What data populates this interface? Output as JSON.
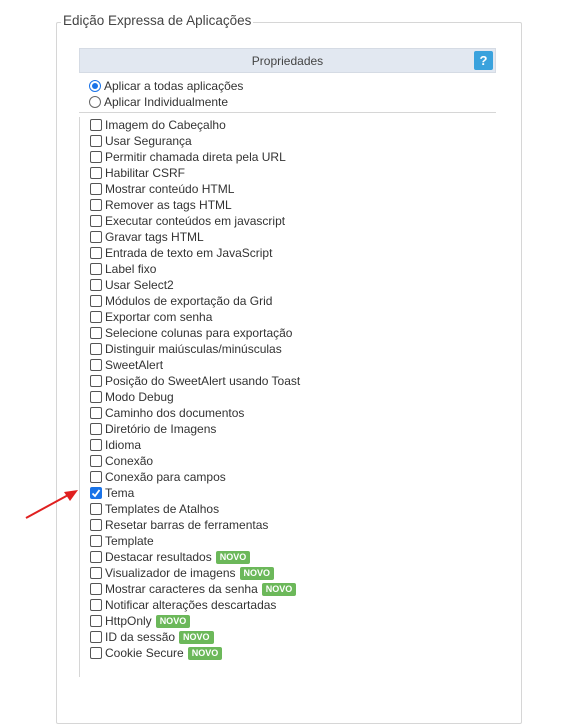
{
  "legend": "Edição Expressa de Aplicações",
  "panel": {
    "title": "Propriedades",
    "help_label": "?"
  },
  "apply_options": [
    {
      "label": "Aplicar a todas aplicações",
      "selected": true
    },
    {
      "label": "Aplicar Individualmente",
      "selected": false
    }
  ],
  "properties": [
    {
      "label": "Imagem do Cabeçalho",
      "checked": false,
      "badge": ""
    },
    {
      "label": "Usar Segurança",
      "checked": false,
      "badge": ""
    },
    {
      "label": "Permitir chamada direta pela URL",
      "checked": false,
      "badge": ""
    },
    {
      "label": "Habilitar CSRF",
      "checked": false,
      "badge": ""
    },
    {
      "label": "Mostrar conteúdo HTML",
      "checked": false,
      "badge": ""
    },
    {
      "label": "Remover as tags HTML",
      "checked": false,
      "badge": ""
    },
    {
      "label": "Executar conteúdos em javascript",
      "checked": false,
      "badge": ""
    },
    {
      "label": "Gravar tags HTML",
      "checked": false,
      "badge": ""
    },
    {
      "label": "Entrada de texto em JavaScript",
      "checked": false,
      "badge": ""
    },
    {
      "label": "Label fixo",
      "checked": false,
      "badge": ""
    },
    {
      "label": "Usar Select2",
      "checked": false,
      "badge": ""
    },
    {
      "label": "Módulos de exportação da Grid",
      "checked": false,
      "badge": ""
    },
    {
      "label": "Exportar com senha",
      "checked": false,
      "badge": ""
    },
    {
      "label": "Selecione colunas para exportação",
      "checked": false,
      "badge": ""
    },
    {
      "label": "Distinguir maiúsculas/minúsculas",
      "checked": false,
      "badge": ""
    },
    {
      "label": "SweetAlert",
      "checked": false,
      "badge": ""
    },
    {
      "label": "Posição do SweetAlert usando Toast",
      "checked": false,
      "badge": ""
    },
    {
      "label": "Modo Debug",
      "checked": false,
      "badge": ""
    },
    {
      "label": "Caminho dos documentos",
      "checked": false,
      "badge": ""
    },
    {
      "label": "Diretório de Imagens",
      "checked": false,
      "badge": ""
    },
    {
      "label": "Idioma",
      "checked": false,
      "badge": ""
    },
    {
      "label": "Conexão",
      "checked": false,
      "badge": ""
    },
    {
      "label": "Conexão para campos",
      "checked": false,
      "badge": ""
    },
    {
      "label": "Tema",
      "checked": true,
      "badge": ""
    },
    {
      "label": "Templates de Atalhos",
      "checked": false,
      "badge": ""
    },
    {
      "label": "Resetar barras de ferramentas",
      "checked": false,
      "badge": ""
    },
    {
      "label": "Template",
      "checked": false,
      "badge": ""
    },
    {
      "label": "Destacar resultados",
      "checked": false,
      "badge": "NOVO"
    },
    {
      "label": "Visualizador de imagens",
      "checked": false,
      "badge": "NOVO"
    },
    {
      "label": "Mostrar caracteres da senha",
      "checked": false,
      "badge": "NOVO"
    },
    {
      "label": "Notificar alterações descartadas",
      "checked": false,
      "badge": ""
    },
    {
      "label": "HttpOnly",
      "checked": false,
      "badge": "NOVO"
    },
    {
      "label": "ID da sessão",
      "checked": false,
      "badge": "NOVO"
    },
    {
      "label": "Cookie Secure",
      "checked": false,
      "badge": "NOVO"
    }
  ],
  "colors": {
    "accent": "#1a73e8",
    "help": "#3aa2dd",
    "badge": "#6cb85a",
    "arrow": "#e02020"
  }
}
